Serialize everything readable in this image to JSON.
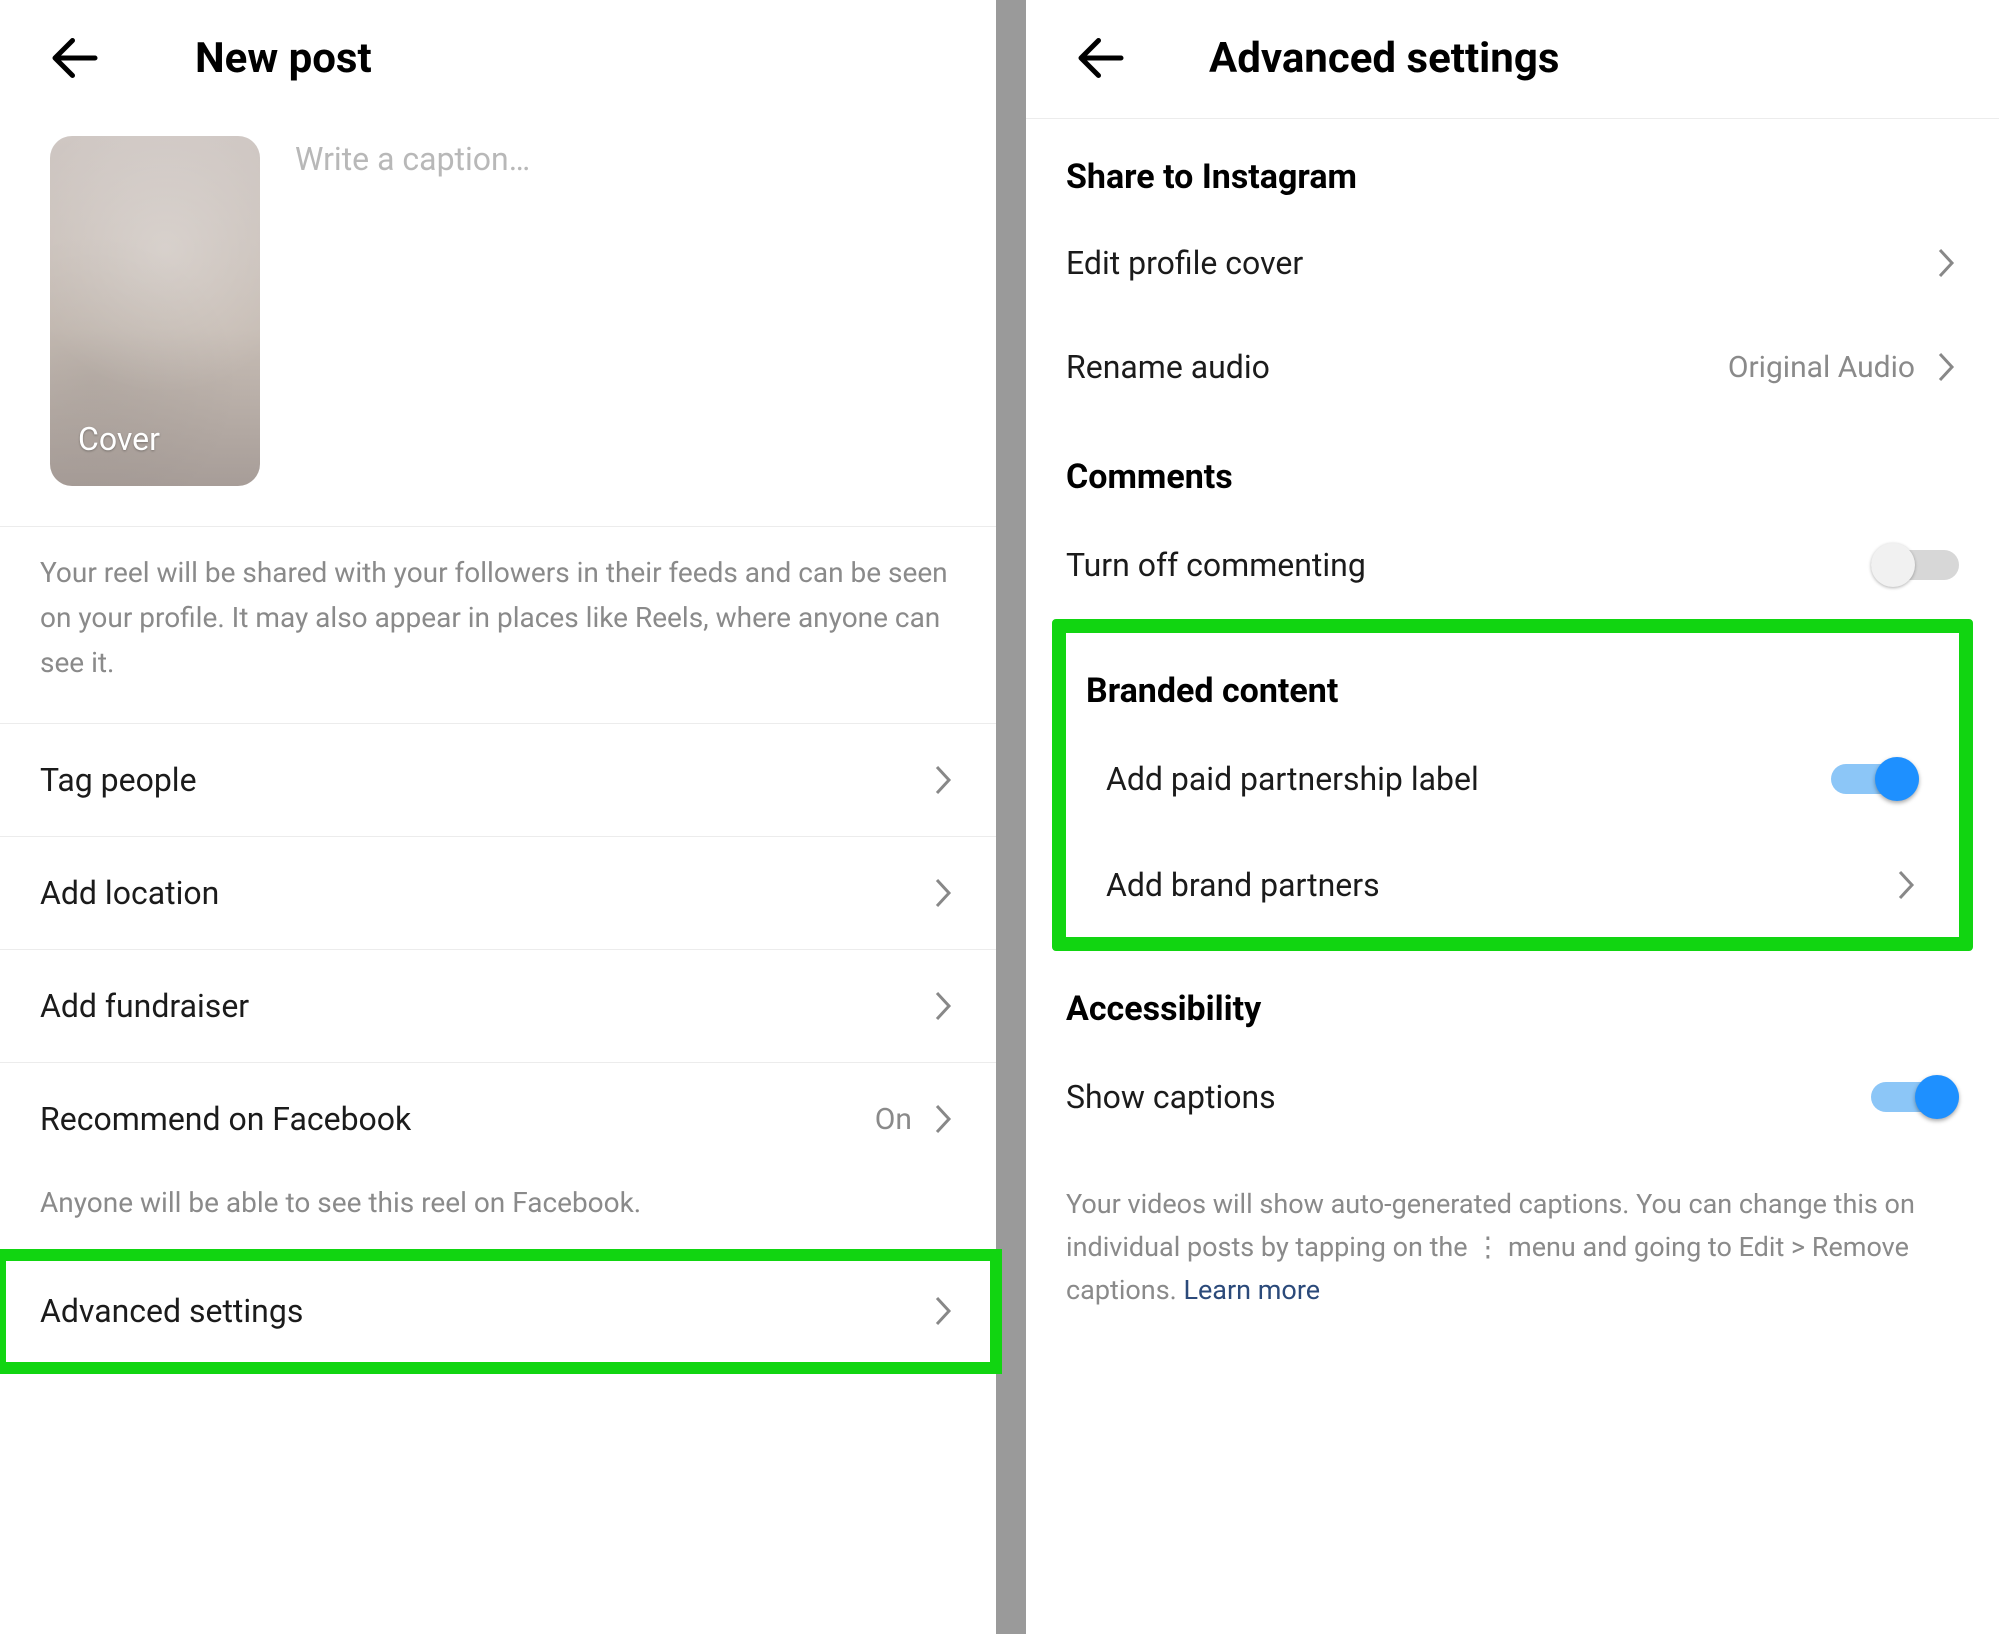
{
  "left": {
    "title": "New post",
    "cover_label": "Cover",
    "caption_placeholder": "Write a caption…",
    "info_text": "Your reel will be shared with your followers in their feeds and can be seen on your profile. It may also appear in places like Reels, where anyone can see it.",
    "rows": {
      "tag_people": "Tag people",
      "add_location": "Add location",
      "add_fundraiser": "Add fundraiser",
      "recommend_fb": "Recommend on Facebook",
      "recommend_fb_value": "On",
      "recommend_fb_sub": "Anyone will be able to see this reel on Facebook.",
      "advanced": "Advanced settings"
    }
  },
  "right": {
    "title": "Advanced settings",
    "share_section": "Share to Instagram",
    "edit_cover": "Edit profile cover",
    "rename_audio": "Rename audio",
    "rename_audio_value": "Original Audio",
    "comments_section": "Comments",
    "turn_off_commenting": "Turn off commenting",
    "branded_section": "Branded content",
    "paid_partnership": "Add paid partnership label",
    "brand_partners": "Add brand partners",
    "accessibility_section": "Accessibility",
    "show_captions": "Show captions",
    "note_text": "Your videos will show auto-generated captions. You can change this on individual posts by tapping on the  ⋮  menu and going to Edit > Remove captions. ",
    "learn_more": "Learn more"
  }
}
